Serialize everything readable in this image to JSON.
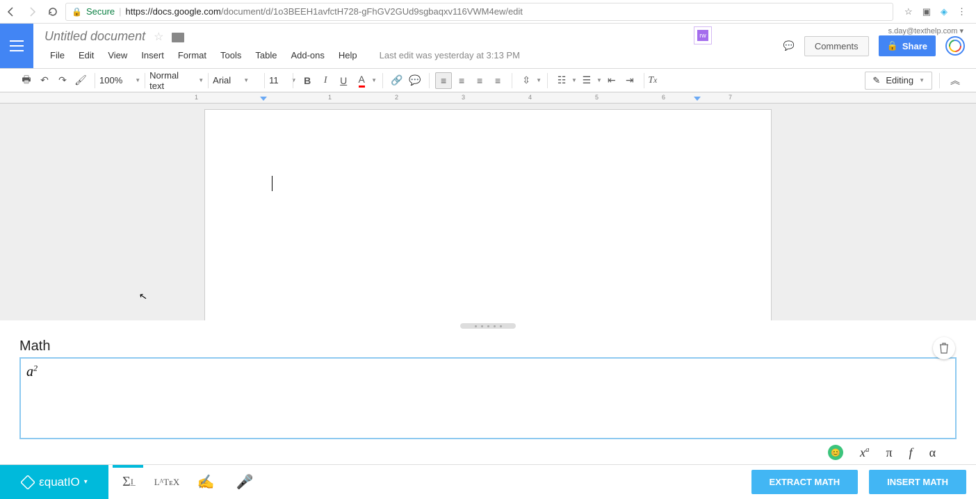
{
  "browser": {
    "secure_label": "Secure",
    "url_host": "https://docs.google.com",
    "url_path": "/document/d/1o3BEEH1avfctH728-gFhGV2GUd9sgbaqxv116VWM4ew/edit"
  },
  "header": {
    "doc_title": "Untitled document",
    "user_email": "s.day@texthelp.com",
    "ext_badge": "rw",
    "comments_btn": "Comments",
    "share_btn": "Share",
    "status_text": "Last edit was yesterday at 3:13 PM",
    "menu": {
      "file": "File",
      "edit": "Edit",
      "view": "View",
      "insert": "Insert",
      "format": "Format",
      "tools": "Tools",
      "table": "Table",
      "addons": "Add-ons",
      "help": "Help"
    }
  },
  "toolbar": {
    "zoom": "100%",
    "style": "Normal text",
    "font": "Arial",
    "size": "11",
    "editing_mode": "Editing"
  },
  "ruler": {
    "marks": [
      "1",
      "1",
      "2",
      "3",
      "4",
      "5",
      "6",
      "7"
    ]
  },
  "math_panel": {
    "label": "Math",
    "expr_base": "a",
    "expr_sup": "2",
    "icons": {
      "xa": "x",
      "xa_sup": "a",
      "pi": "π",
      "f": "f",
      "alpha": "α"
    }
  },
  "equatio": {
    "logo_text": "εquatIO",
    "latex_label": "LᴬTᴇX",
    "extract_btn": "EXTRACT MATH",
    "insert_btn": "INSERT MATH"
  }
}
